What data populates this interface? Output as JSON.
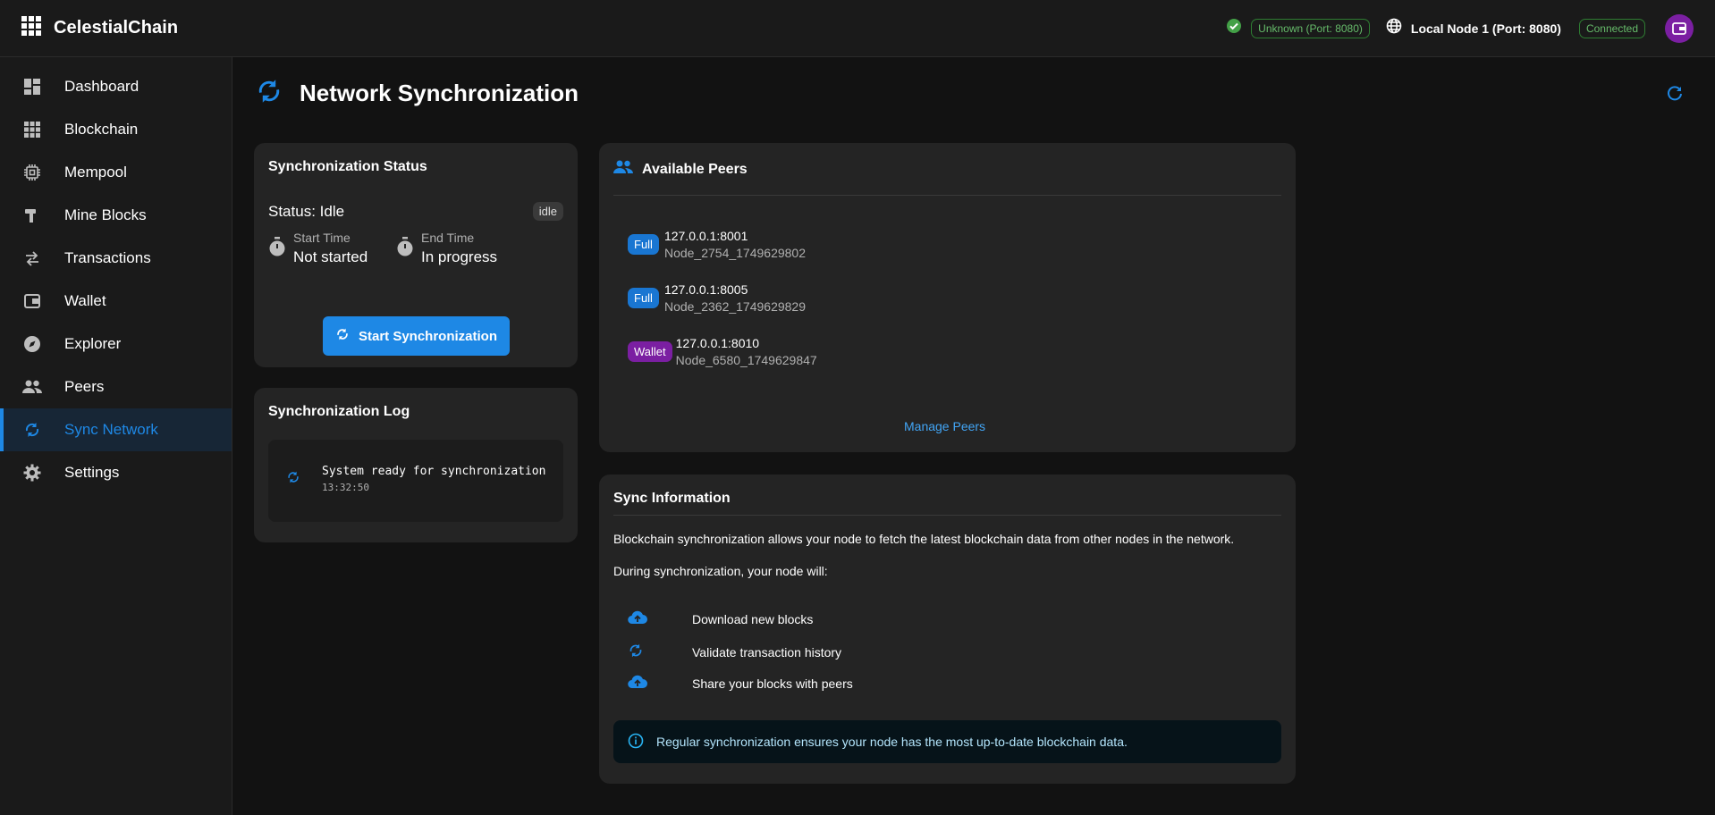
{
  "app": {
    "title": "CelestialChain"
  },
  "topbar": {
    "unknown_chip": "Unknown (Port: 8080)",
    "node_label": "Local Node 1 (Port: 8080)",
    "connected_chip": "Connected",
    "icons": [
      "grid-icon",
      "check-circle-icon",
      "globe-icon",
      "wallet-avatar-icon"
    ]
  },
  "sidebar": {
    "items": [
      {
        "label": "Dashboard",
        "icon": "dashboard-icon"
      },
      {
        "label": "Blockchain",
        "icon": "grid-icon"
      },
      {
        "label": "Mempool",
        "icon": "chip-icon"
      },
      {
        "label": "Mine Blocks",
        "icon": "hammer-icon"
      },
      {
        "label": "Transactions",
        "icon": "swap-icon"
      },
      {
        "label": "Wallet",
        "icon": "wallet-icon"
      },
      {
        "label": "Explorer",
        "icon": "compass-icon"
      },
      {
        "label": "Peers",
        "icon": "people-icon"
      },
      {
        "label": "Sync Network",
        "icon": "sync-icon",
        "active": true
      },
      {
        "label": "Settings",
        "icon": "gear-icon"
      }
    ]
  },
  "page": {
    "title": "Network Synchronization"
  },
  "sync_status": {
    "title": "Synchronization Status",
    "status_text": "Status: Idle",
    "status_badge": "idle",
    "start_label": "Start Time",
    "start_value": "Not started",
    "end_label": "End Time",
    "end_value": "In progress",
    "button_label": "Start Synchronization"
  },
  "sync_log": {
    "title": "Synchronization Log",
    "entries": [
      {
        "message": "System ready for synchronization",
        "time": "13:32:50"
      }
    ]
  },
  "peers": {
    "title": "Available Peers",
    "list": [
      {
        "type": "Full",
        "address": "127.0.0.1:8001",
        "name": "Node_2754_1749629802",
        "color": "#1976d2"
      },
      {
        "type": "Full",
        "address": "127.0.0.1:8005",
        "name": "Node_2362_1749629829",
        "color": "#1976d2"
      },
      {
        "type": "Wallet",
        "address": "127.0.0.1:8010",
        "name": "Node_6580_1749629847",
        "color": "#7b1fa2"
      }
    ],
    "manage_link": "Manage Peers"
  },
  "sync_info": {
    "title": "Sync Information",
    "paragraph1": "Blockchain synchronization allows your node to fetch the latest blockchain data from other nodes in the network.",
    "paragraph2": "During synchronization, your node will:",
    "items": [
      {
        "label": "Download new blocks",
        "icon": "cloud-upload-icon"
      },
      {
        "label": "Validate transaction history",
        "icon": "sync-icon"
      },
      {
        "label": "Share your blocks with peers",
        "icon": "cloud-upload-icon"
      }
    ],
    "alert": "Regular synchronization ensures your node has the most up-to-date blockchain data."
  },
  "colors": {
    "accent": "#1e88e5",
    "success": "#66bb6a",
    "purple": "#7b1fa2"
  }
}
